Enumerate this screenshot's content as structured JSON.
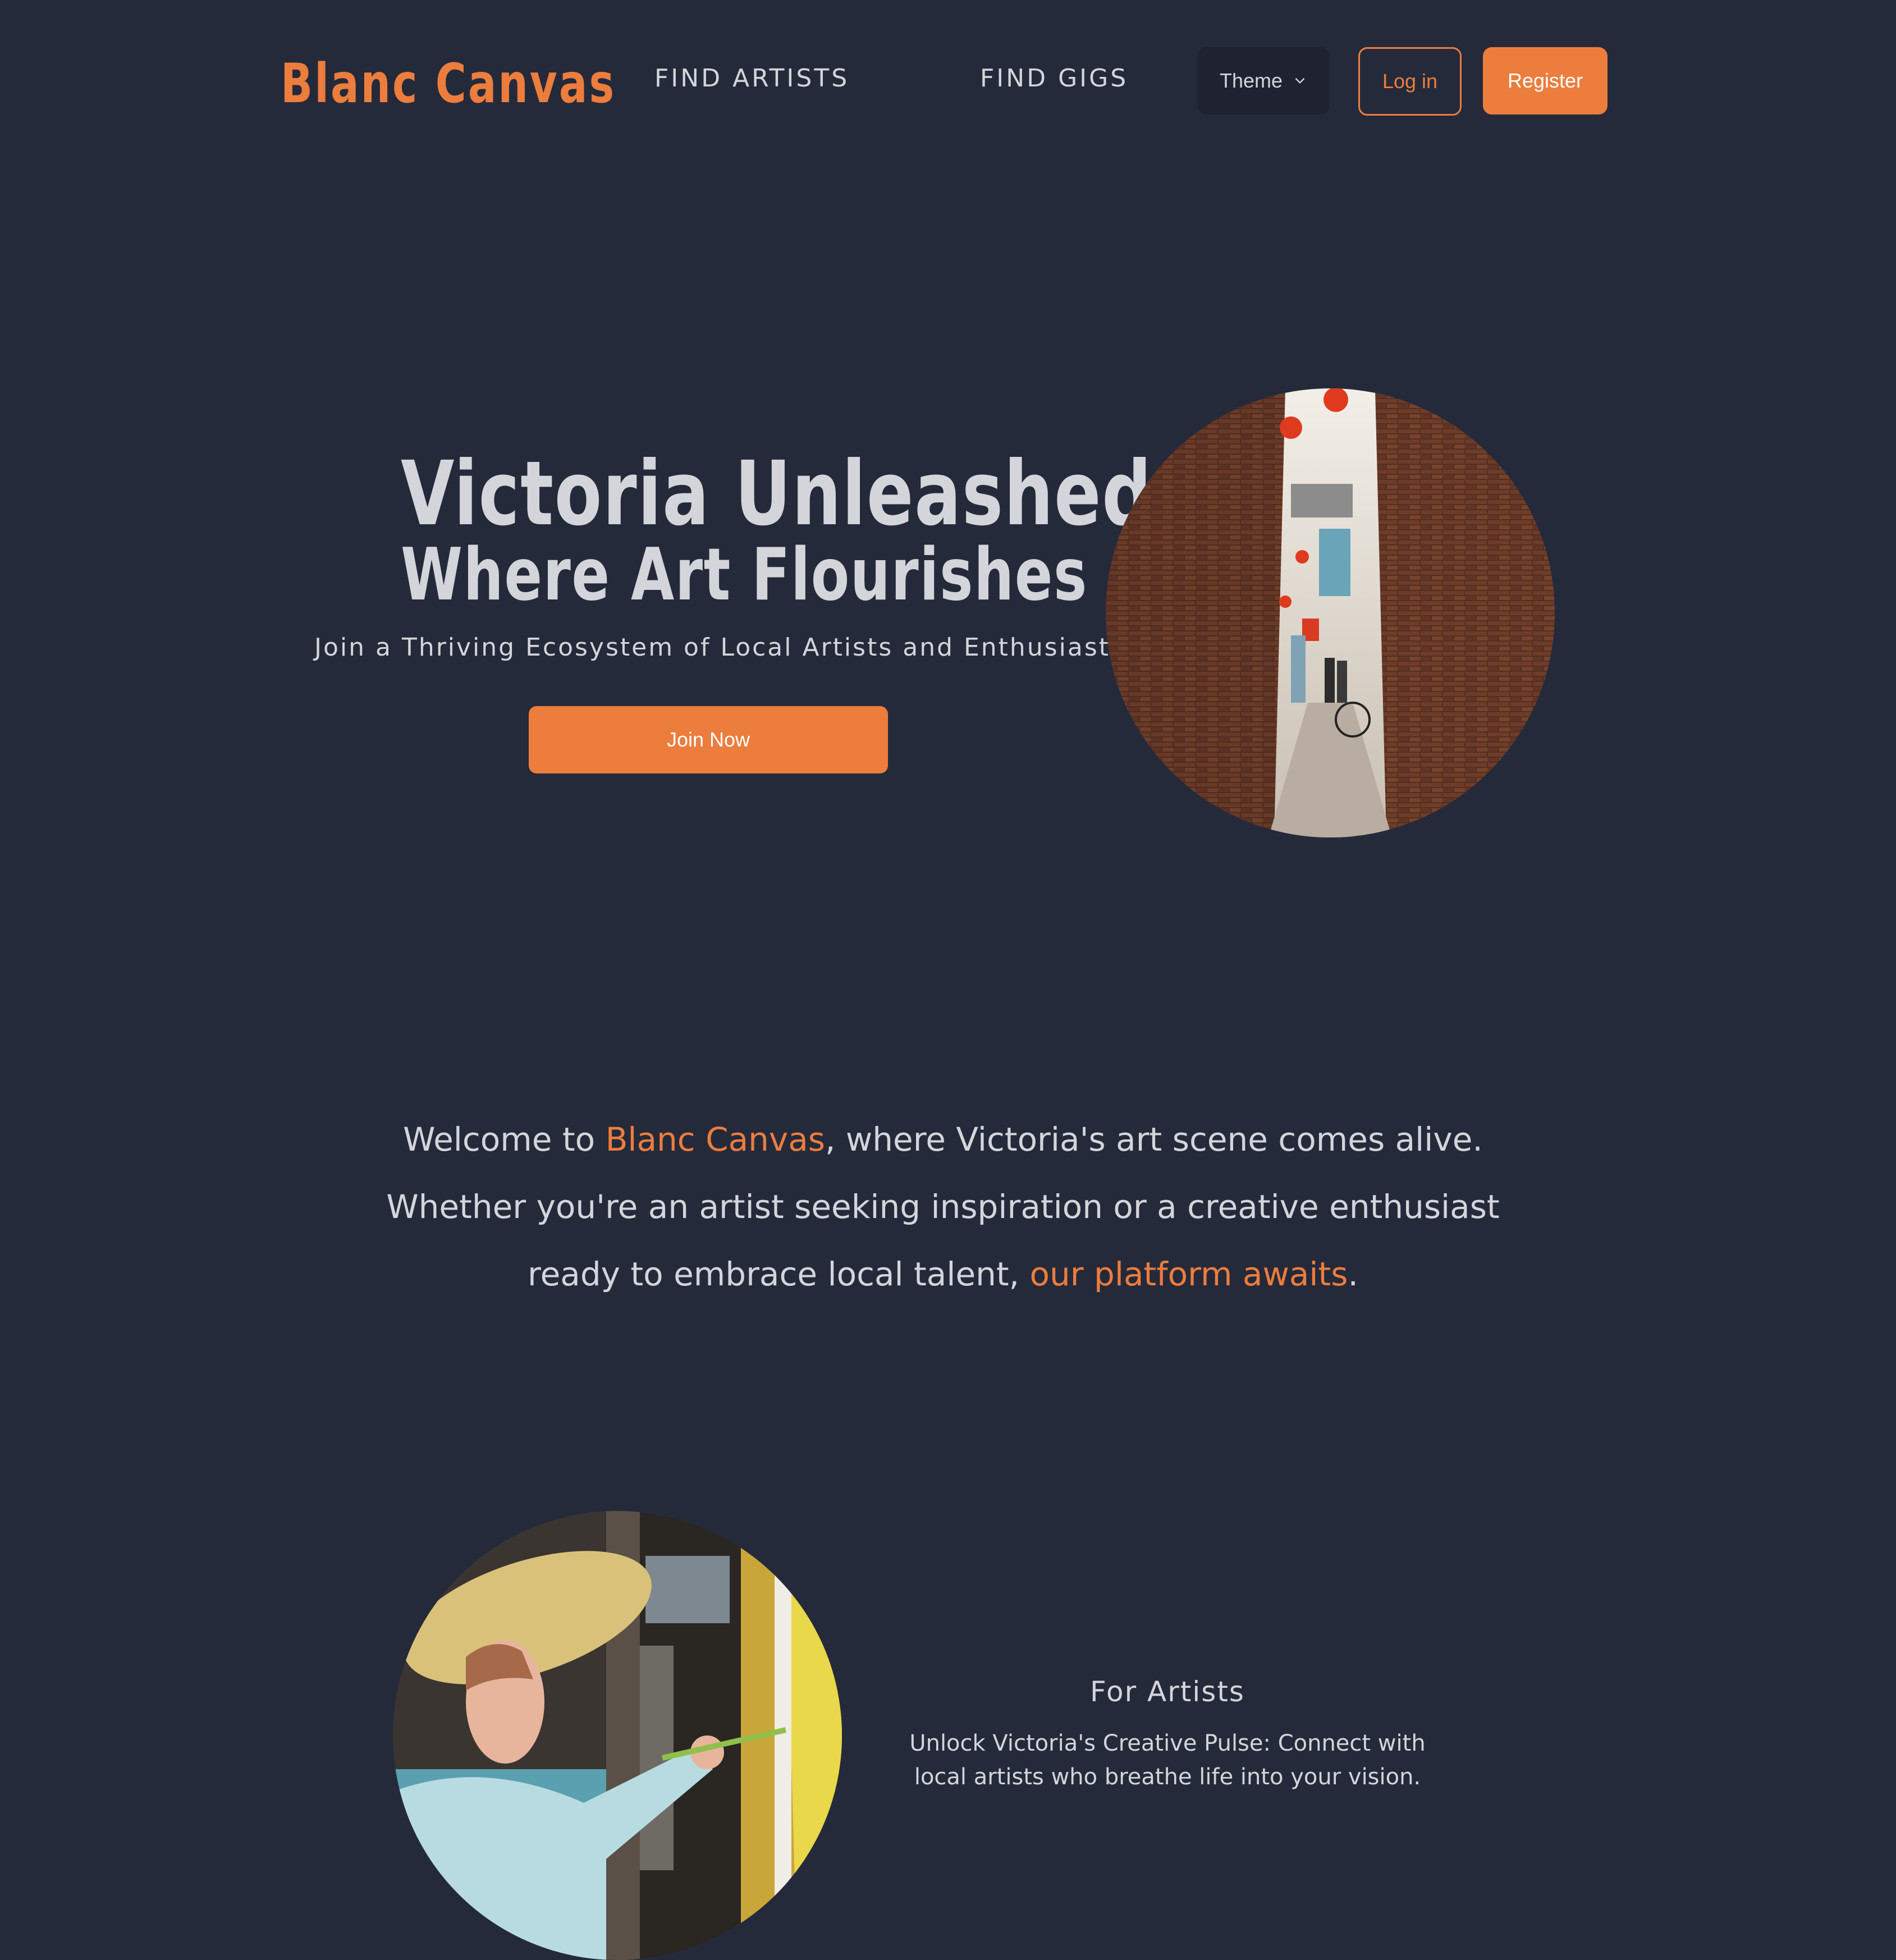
{
  "navbar": {
    "brand": "Blanc Canvas",
    "links": [
      "FIND ARTISTS",
      "FIND GIGS"
    ],
    "theme_label": "Theme",
    "login_label": "Log in",
    "register_label": "Register"
  },
  "hero": {
    "title": "Victoria Unleashed",
    "subtitle": "Where Art Flourishes",
    "tagline": "Join a Thriving Ecosystem of Local Artists and Enthusiasts",
    "cta_label": "Join Now"
  },
  "welcome": {
    "part1": "Welcome to ",
    "brand": "Blanc Canvas",
    "part2": ", where Victoria's art scene comes alive. Whether you're an artist seeking inspiration or a creative enthusiast ready to embrace local talent, ",
    "link": "our platform awaits",
    "part3": "."
  },
  "for_artists": {
    "heading": "For Artists",
    "description": "Unlock Victoria's Creative Pulse: Connect with local artists who breathe life into your vision."
  },
  "colors": {
    "background": "#252a3b",
    "accent": "#ec7d3d",
    "text": "#d4d5da"
  },
  "icons": {
    "theme_dropdown": "chevron-down-icon"
  }
}
